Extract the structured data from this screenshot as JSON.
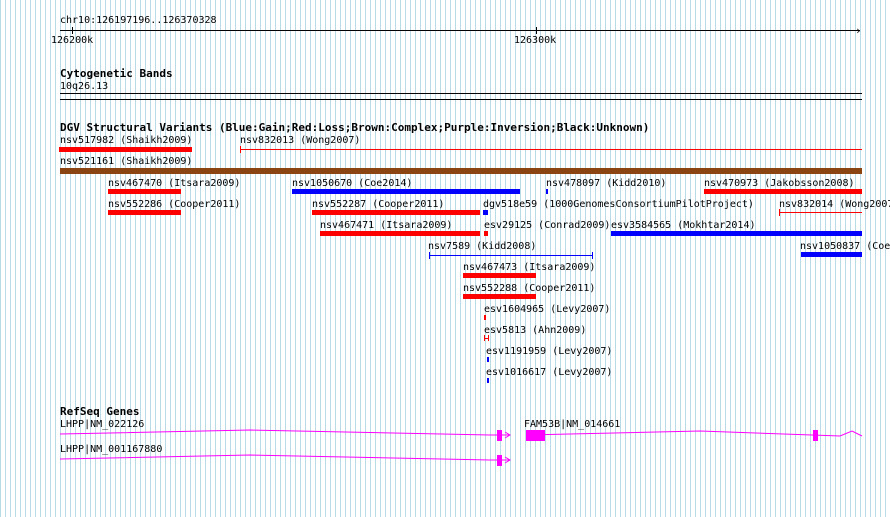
{
  "ruler": {
    "region": "chr10:126197196..126370328",
    "tick_left": "126200k",
    "tick_right": "126300k"
  },
  "cytobands": {
    "title": "Cytogenetic Bands",
    "band": "10q26.13"
  },
  "dgv": {
    "title": "DGV Structural Variants (Blue:Gain;Red:Loss;Brown:Complex;Purple:Inversion;Black:Unknown)",
    "colors": {
      "gain": "#0000ff",
      "loss": "#ff0000",
      "complex": "#8b4513"
    },
    "labels": {
      "nsv517982": "nsv517982 (Shaikh2009)",
      "nsv832013": "nsv832013 (Wong2007)",
      "nsv521161": "nsv521161 (Shaikh2009)",
      "nsv467470": "nsv467470 (Itsara2009)",
      "nsv1050670": "nsv1050670 (Coe2014)",
      "nsv478097": "nsv478097 (Kidd2010)",
      "nsv470973": "nsv470973 (Jakobsson2008)",
      "nsv552286": "nsv552286 (Cooper2011)",
      "nsv552287": "nsv552287 (Cooper2011)",
      "dgv518e59": "dgv518e59 (1000GenomesConsortiumPilotProject)",
      "nsv832014": "nsv832014 (Wong2007",
      "nsv467471": "nsv467471 (Itsara2009)",
      "esv29125": "esv29125 (Conrad2009)",
      "esv3584565": "esv3584565 (Mokhtar2014)",
      "nsv7589": "nsv7589 (Kidd2008)",
      "nsv1050837": "nsv1050837 (Coe",
      "nsv467473": "nsv467473 (Itsara2009)",
      "nsv552288": "nsv552288 (Cooper2011)",
      "esv1604965": "esv1604965 (Levy2007)",
      "esv5813": "esv5813 (Ahn2009)",
      "esv1191959": "esv1191959 (Levy2007)",
      "esv1016617": "esv1016617 (Levy2007)"
    }
  },
  "refseq": {
    "title": "RefSeq Genes",
    "color": "#ff00ff",
    "genes": {
      "g1": "LHPP|NM_022126",
      "g2": "LHPP|NM_001167880",
      "g3": "FAM53B|NM_014661"
    }
  }
}
